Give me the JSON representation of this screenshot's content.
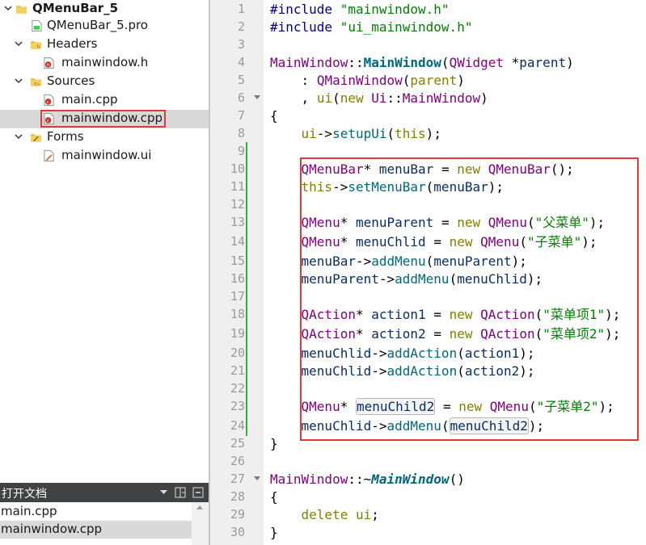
{
  "project_tree": {
    "project_name": "QMenuBar_5",
    "pro_file": "QMenuBar_5.pro",
    "groups": {
      "headers": {
        "label": "Headers",
        "files": [
          "mainwindow.h"
        ]
      },
      "sources": {
        "label": "Sources",
        "files": [
          "main.cpp",
          "mainwindow.cpp"
        ]
      },
      "forms": {
        "label": "Forms",
        "files": [
          "mainwindow.ui"
        ]
      }
    },
    "selected_file": "mainwindow.cpp"
  },
  "open_documents": {
    "title": "打开文档",
    "files": [
      "main.cpp",
      "mainwindow.cpp"
    ],
    "selected": "mainwindow.cpp"
  },
  "colors": {
    "highlight_border": "#e03a3a",
    "change_bar": "#3caa3c",
    "panel_header": "#404244"
  },
  "editor": {
    "line_numbers": [
      "1",
      "2",
      "3",
      "4",
      "5",
      "6",
      "7",
      "8",
      "9",
      "10",
      "11",
      "12",
      "13",
      "14",
      "15",
      "16",
      "17",
      "18",
      "19",
      "20",
      "21",
      "22",
      "23",
      "24",
      "25",
      "26",
      "27",
      "28",
      "29",
      "30"
    ],
    "lines": [
      "#include \"mainwindow.h\"",
      "#include \"ui_mainwindow.h\"",
      "",
      "MainWindow::MainWindow(QWidget *parent)",
      "    : QMainWindow(parent)",
      "    , ui(new Ui::MainWindow)",
      "{",
      "    ui->setupUi(this);",
      "",
      "    QMenuBar* menuBar = new QMenuBar();",
      "    this->setMenuBar(menuBar);",
      "",
      "    QMenu* menuParent = new QMenu(\"父菜单\");",
      "    QMenu* menuChlid = new QMenu(\"子菜单\");",
      "    menuBar->addMenu(menuParent);",
      "    menuParent->addMenu(menuChlid);",
      "",
      "    QAction* action1 = new QAction(\"菜单项1\");",
      "    QAction* action2 = new QAction(\"菜单项2\");",
      "    menuChlid->addAction(action1);",
      "    menuChlid->addAction(action2);",
      "",
      "    QMenu* menuChild2 = new QMenu(\"子菜单2\");",
      "    menuChlid->addMenu(menuChild2);",
      "}",
      "",
      "MainWindow::~MainWindow()",
      "{",
      "    delete ui;",
      "}"
    ]
  }
}
